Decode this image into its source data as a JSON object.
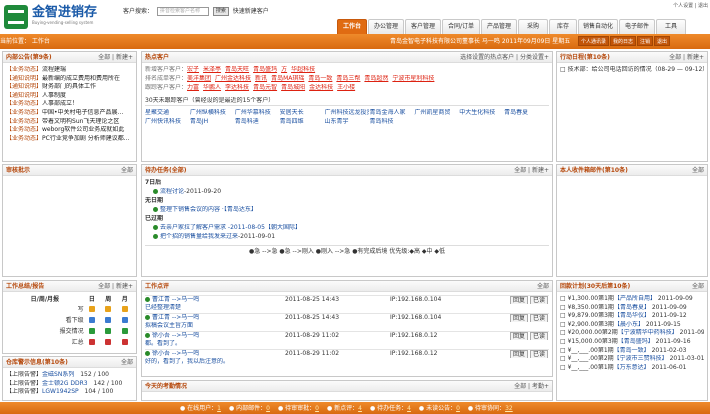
{
  "brand": {
    "name": "金智进销存",
    "tagline": "Buying-vending-selling system"
  },
  "search": {
    "label": "客户搜索：",
    "placeholder": "拼音检索客户名称",
    "button": "搜索",
    "link": "快速新建客户"
  },
  "top_links": "个人设置 | 退出",
  "tabs": [
    {
      "label": "工作台",
      "active": true
    },
    {
      "label": "办公管理"
    },
    {
      "label": "客户管理"
    },
    {
      "label": "合同/订单"
    },
    {
      "label": "产品管理"
    },
    {
      "label": "采购"
    },
    {
      "label": "库存"
    },
    {
      "label": "销售自动化"
    },
    {
      "label": "电子邮件"
    },
    {
      "label": "工具"
    }
  ],
  "bar": {
    "crumb": "当前位置：  工作台",
    "user": "青岛金智电子科技有限公司董事长  马一鸣   2011年09月09日  星期五",
    "buttons": [
      "个人通讯录",
      "我的日志",
      "注销",
      "退出"
    ]
  },
  "panel_notice": {
    "title": "内部公告(第9条)",
    "actions": "全部 | 新建+",
    "items": [
      [
        "【业务动态】",
        "流程建瑞"
      ],
      [
        "【通知说明】",
        "最新编的成立费用和费用所在"
      ],
      [
        "【通知说明】",
        "财务部门的具体工作"
      ],
      [
        "【通知说明】",
        "人事制度"
      ],
      [
        "【业务动态】",
        "人事部成立！"
      ],
      [
        "【业务动态】",
        "中国•中关村电子信息产品展..."
      ],
      [
        "【业务动态】",
        "带着文明构Sun飞天理论之区"
      ],
      [
        "【业务动态】",
        "weborg软件公司业务成就如此"
      ],
      [
        "【业务动态】",
        "PC行业竞争加剧 分析师建议都..."
      ]
    ]
  },
  "panel_hot": {
    "title": "热点客户",
    "actions": "选择设置的热点客户 | 分类设置+",
    "rows": [
      {
        "label": "新增客户客户：",
        "names": [
          "宏子",
          "米泽亭",
          "青岛天旺",
          "青岛盛玛",
          "方",
          "华超科技"
        ]
      },
      {
        "label": "排名成单客户：",
        "names": [
          "美洋集团",
          "广州金达科技",
          "新讯",
          "青岛MA琪瑶",
          "青岛一致",
          "青岛三帮",
          "青岛超然",
          "宁波市星利科技"
        ]
      },
      {
        "label": "跟踪客户客户：",
        "names": [
          "力富",
          "华鹏人",
          "李达科技",
          "青岛元智",
          "青岛城阳",
          "金达科技",
          "王小楼"
        ]
      }
    ],
    "recent_label": "30天未跟踪客户（曾经设的是最近的15个客户）",
    "recent": [
      "星聚交通",
      "广州纵横科技",
      "广州华慕科技",
      "安居天长",
      "广州科技远龙投资",
      "青岛金海人家",
      "广州凯星商贸",
      "中大生化科技",
      "青岛春夏",
      "广州快讯科技",
      "青岛JH",
      "青岛科迪",
      "青岛四维",
      "山东青宇",
      "青岛科技"
    ]
  },
  "panel_action": {
    "title": "行动日程(第10条)",
    "actions": "全部 | 新建+",
    "items": [
      "技术部：给公司电话回访的情况（08-29 — 09-12）【青岛"
    ]
  },
  "panel_approve": {
    "title": "审核批示",
    "actions": "全部"
  },
  "panel_todo": {
    "title": "待办任务(全部)",
    "actions": "全部 | 新建+",
    "groups": [
      {
        "label": "7日后",
        "items": [
          {
            "text": "流程讨论",
            "date": "-2011-09-20"
          }
        ]
      },
      {
        "label": "无日期",
        "items": [
          {
            "text": "整理下销售会议的内容 ·【青岛达东】",
            "date": ""
          }
        ]
      },
      {
        "label": "已过期",
        "items": [
          {
            "text": "去亲户家拉了解客户需求 -2011-08-05【朝大国际】",
            "date": ""
          },
          {
            "text": "把个招的销售量给我发来过来",
            "date": "-2011-09-01"
          }
        ]
      }
    ],
    "legend": "●急 -->急  ●急 -->刚入  ●刚入 -->急  ●有完成后境  优先级:◆高  ◆中  ◆低"
  },
  "panel_mail": {
    "title": "本人收件箱邮件(第10条)",
    "actions": "全部"
  },
  "panel_summary": {
    "title": "工作总结/报告",
    "actions": "全部 | 新建+",
    "cols": [
      "日/周/月报",
      "日",
      "周",
      "月"
    ],
    "rows": [
      "写",
      "看下级",
      "报交情况",
      "汇总"
    ]
  },
  "panel_flow": {
    "title": "工作点评",
    "actions": "全部",
    "items": [
      {
        "head": "曹江青 -->马一鸣",
        "time": "2011-08-25 14:43",
        "ip": "IP:192.168.0.104",
        "desc": "已经整理清楚"
      },
      {
        "head": "曹江青 -->马一鸣",
        "time": "2011-08-25 14:43",
        "ip": "IP:192.168.0.104",
        "desc": "拟稿会议主旨方面"
      },
      {
        "head": "徐小吾 -->马一鸣",
        "time": "2011-08-29 11:02",
        "ip": "IP:192.168.0.12",
        "desc": "都。看到了。"
      },
      {
        "head": "徐小吾 -->马一鸣",
        "time": "2011-08-29 11:02",
        "ip": "IP:192.168.0.12",
        "desc": "好的，看到了，我以后注意的。"
      }
    ],
    "btn_view": "回复",
    "btn_read": "已读"
  },
  "panel_attend": {
    "title": "今天的考勤情况",
    "actions": "全部 | 考勤+"
  },
  "panel_stock": {
    "title": "仓库警示信息(第10条)",
    "actions": "全部",
    "items": [
      [
        "【上限告警】",
        "金磁SN系列",
        "152 / 100"
      ],
      [
        "【上限告警】",
        "金士顿2G DDR3",
        "142 / 100"
      ],
      [
        "【上限告警】",
        "LGW1942SP",
        "104 / 100"
      ]
    ]
  },
  "panel_pay": {
    "title": "回款计划(30天后第10条)",
    "actions": "全部",
    "items": [
      [
        "¥1,300.00第1期",
        "【产品所自用】",
        "2011-09-09"
      ],
      [
        "¥8,350.00第1期",
        "【青岛春夏】",
        "2011-09-09"
      ],
      [
        "¥9,879.00第3期",
        "【青岛华仪】",
        "2011-09-12"
      ],
      [
        "¥2,900.00第3期",
        "【晨小东】",
        "2011-09-15"
      ],
      [
        "¥20,000.00第2期",
        "【宁波精华中药科技】",
        "2011-09-14"
      ],
      [
        "¥15,000.00第3期",
        "【青岛盛玛】",
        "2011-09-16"
      ],
      [
        "¥__,___.00第1期",
        "【青岛一致】",
        "2011-02-03"
      ],
      [
        "¥__,___.00第2期",
        "【宁波市三赞科技】",
        "2011-03-01"
      ],
      [
        "¥__,___.00第1期",
        "【万东意达】",
        "2011-06-01"
      ]
    ]
  },
  "footer": [
    {
      "label": "在线用户：",
      "val": "1"
    },
    {
      "label": "内部邮件：",
      "val": "0"
    },
    {
      "label": "待审审批：",
      "val": "0"
    },
    {
      "label": "新点评：",
      "val": "4"
    },
    {
      "label": "待办任务：",
      "val": "4"
    },
    {
      "label": "未读公告：",
      "val": "0"
    },
    {
      "label": "待审协同：",
      "val": "32"
    }
  ],
  "colors": {
    "accent": "#e06b12",
    "title": "#b5470a",
    "link": "#1a4fa0"
  }
}
